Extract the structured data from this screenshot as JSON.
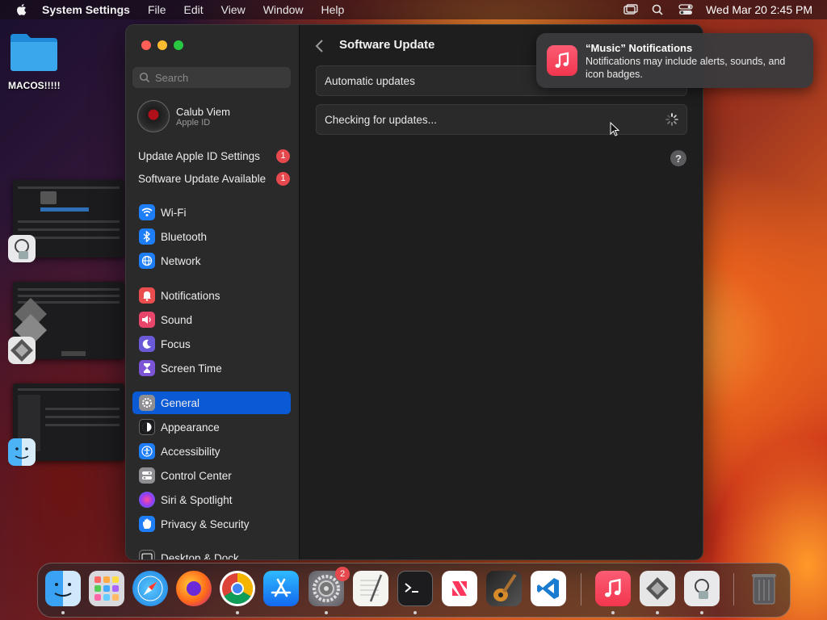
{
  "menubar": {
    "app_name": "System Settings",
    "menus": [
      "File",
      "Edit",
      "View",
      "Window",
      "Help"
    ],
    "clock": "Wed Mar 20  2:45 PM"
  },
  "desktop": {
    "folder_label": "MACOS!!!!!"
  },
  "window": {
    "search_placeholder": "Search",
    "profile": {
      "name": "Calub Viem",
      "sub": "Apple ID"
    },
    "alerts": [
      {
        "label": "Update Apple ID Settings",
        "badge": "1"
      },
      {
        "label": "Software Update Available",
        "badge": "1"
      }
    ],
    "sidebar_items": [
      {
        "label": "Wi-Fi",
        "icon": "wifi-icon",
        "color": "#1e7ef7"
      },
      {
        "label": "Bluetooth",
        "icon": "bluetooth-icon",
        "color": "#1e7ef7"
      },
      {
        "label": "Network",
        "icon": "globe-icon",
        "color": "#1e7ef7"
      },
      {
        "label": "Notifications",
        "icon": "bell-icon",
        "color": "#ea4d4d"
      },
      {
        "label": "Sound",
        "icon": "speaker-icon",
        "color": "#e8456b"
      },
      {
        "label": "Focus",
        "icon": "moon-icon",
        "color": "#6a5ad8"
      },
      {
        "label": "Screen Time",
        "icon": "hourglass-icon",
        "color": "#7b55d6"
      },
      {
        "label": "General",
        "icon": "gear-icon",
        "color": "#8e8e93"
      },
      {
        "label": "Appearance",
        "icon": "appearance-icon",
        "color": "#1c1c1e"
      },
      {
        "label": "Accessibility",
        "icon": "accessibility-icon",
        "color": "#1e7ef7"
      },
      {
        "label": "Control Center",
        "icon": "toggles-icon",
        "color": "#8e8e93"
      },
      {
        "label": "Siri & Spotlight",
        "icon": "siri-icon",
        "color": "#b83bd8"
      },
      {
        "label": "Privacy & Security",
        "icon": "hand-icon",
        "color": "#1e7ef7"
      },
      {
        "label": "Desktop & Dock",
        "icon": "dock-icon",
        "color": "#2c2c2e"
      }
    ],
    "selected": "General",
    "content": {
      "title": "Software Update",
      "automatic_updates": "Automatic updates",
      "checking": "Checking for updates...",
      "help": "?"
    }
  },
  "notification": {
    "title": "“Music” Notifications",
    "body": "Notifications may include alerts, sounds, and icon badges."
  },
  "dock": {
    "settings_badge": "2",
    "apps": [
      "Finder",
      "Launchpad",
      "Safari",
      "Firefox",
      "Chrome",
      "App Store",
      "System Settings",
      "TextEdit",
      "Terminal",
      "News",
      "GarageBand",
      "Visual Studio Code",
      "Music",
      "Boot Camp Assistant",
      "Disk Utility",
      "Trash"
    ]
  }
}
